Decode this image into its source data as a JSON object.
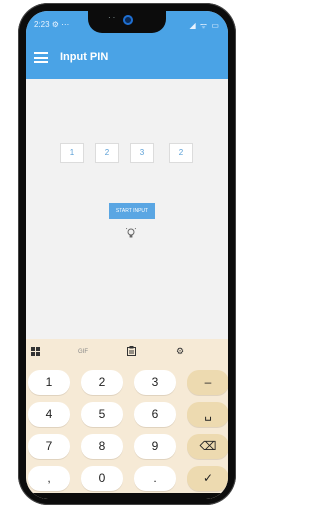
{
  "status_bar": {
    "time": "2:23 ⚙ ⋯",
    "icons": "◢ ᯤ ▭"
  },
  "app_bar": {
    "title": "Input PIN"
  },
  "pin_digits": [
    "1",
    "2",
    "3",
    "2"
  ],
  "start_button_label": "START INPUT",
  "keyboard": {
    "toolbar": {
      "gif_label": "GIF"
    },
    "keys": {
      "k1": "1",
      "k2": "2",
      "k3": "3",
      "minus": "–",
      "k4": "4",
      "k5": "5",
      "k6": "6",
      "space": "␣",
      "k7": "7",
      "k8": "8",
      "k9": "9",
      "backspace": "⌫",
      "comma": ",",
      "k0": "0",
      "period": ".",
      "enter": "✓"
    }
  },
  "colors": {
    "primary": "#4aa3e6",
    "keyboard_bg": "#f6ead6",
    "fn_key": "#eddab0"
  },
  "icons": [
    "menu-icon",
    "lightbulb-icon",
    "grid-icon",
    "clipboard-icon",
    "gear-icon",
    "mic-icon"
  ]
}
